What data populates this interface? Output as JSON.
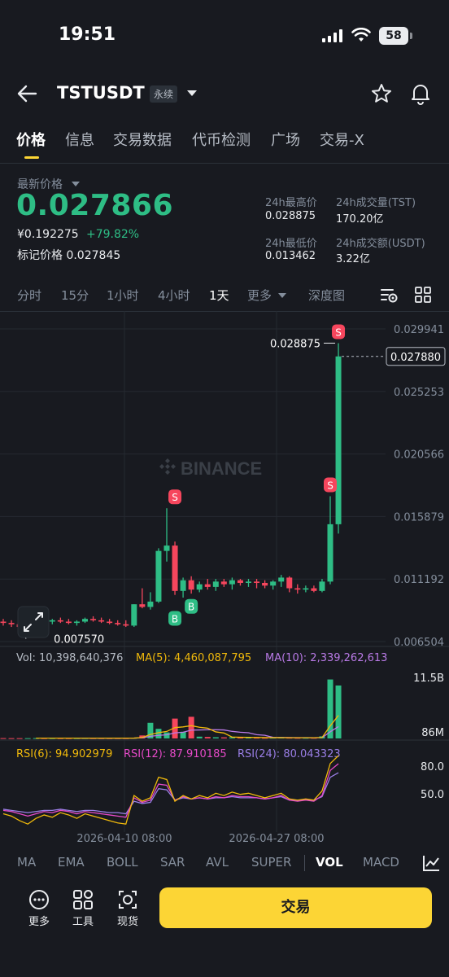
{
  "status_bar": {
    "time": "19:51",
    "battery": "58"
  },
  "header": {
    "symbol": "TSTUSDT",
    "contract_type": "永续"
  },
  "tabs": [
    "价格",
    "信息",
    "交易数据",
    "代币检测",
    "广场",
    "交易-X"
  ],
  "price_block": {
    "latest_label": "最新价格",
    "last_price": "0.027866",
    "cny_price": "¥0.192275",
    "change_pct": "+79.82%",
    "mark_label": "标记价格",
    "mark_price": "0.027845",
    "high_label": "24h最高价",
    "high_value": "0.028875",
    "vol_label": "24h成交量(TST)",
    "vol_value": "170.20亿",
    "low_label": "24h最低价",
    "low_value": "0.013462",
    "turnover_label": "24h成交额(USDT)",
    "turnover_value": "3.22亿"
  },
  "intervals": {
    "items": [
      "分时",
      "15分",
      "1小时",
      "4小时",
      "1天",
      "更多",
      "深度图"
    ],
    "active": "1天"
  },
  "chart_labels": {
    "watermark": "BINANCE",
    "high_marker": "0.028875",
    "low_marker": "0.007570",
    "current_price_tag": "0.027880",
    "vol_line": "Vol: 10,398,640,376",
    "ma5_line": "MA(5): 4,460,087,795",
    "ma10_line": "MA(10): 2,339,262,613",
    "rsi6_line": "RSI(6): 94.902979",
    "rsi12_line": "RSI(12): 87.910185",
    "rsi24_line": "RSI(24): 80.043323",
    "vol_ticks": [
      "11.5B",
      "86M"
    ],
    "rsi_ticks": [
      "80.0",
      "50.0"
    ]
  },
  "chart_data": {
    "type": "candlestick",
    "y_ticks": [
      "0.029941",
      "0.025253",
      "0.020566",
      "0.015879",
      "0.011192",
      "0.006504"
    ],
    "x_ticks": [
      "2026-04-10 08:00",
      "2026-04-27 08:00"
    ],
    "ylim": [
      0.006504,
      0.029941
    ],
    "annotations": {
      "high": "0.028875",
      "low": "0.007570",
      "last": "0.027880"
    },
    "candles": [
      {
        "o": 0.008,
        "h": 0.0082,
        "l": 0.0077,
        "c": 0.0079
      },
      {
        "o": 0.0079,
        "h": 0.0081,
        "l": 0.0076,
        "c": 0.0078
      },
      {
        "o": 0.0078,
        "h": 0.008,
        "l": 0.00757,
        "c": 0.0076
      },
      {
        "o": 0.0076,
        "h": 0.0079,
        "l": 0.0075,
        "c": 0.0078
      },
      {
        "o": 0.0078,
        "h": 0.0082,
        "l": 0.0077,
        "c": 0.0081
      },
      {
        "o": 0.0081,
        "h": 0.0083,
        "l": 0.0079,
        "c": 0.008
      },
      {
        "o": 0.008,
        "h": 0.0082,
        "l": 0.0078,
        "c": 0.0081
      },
      {
        "o": 0.0081,
        "h": 0.0083,
        "l": 0.0079,
        "c": 0.008
      },
      {
        "o": 0.008,
        "h": 0.0082,
        "l": 0.0078,
        "c": 0.0079
      },
      {
        "o": 0.0079,
        "h": 0.0081,
        "l": 0.0077,
        "c": 0.008
      },
      {
        "o": 0.008,
        "h": 0.0083,
        "l": 0.0079,
        "c": 0.0082
      },
      {
        "o": 0.0082,
        "h": 0.0084,
        "l": 0.008,
        "c": 0.0081
      },
      {
        "o": 0.0081,
        "h": 0.0083,
        "l": 0.0079,
        "c": 0.008
      },
      {
        "o": 0.008,
        "h": 0.0082,
        "l": 0.0078,
        "c": 0.0079
      },
      {
        "o": 0.0079,
        "h": 0.0081,
        "l": 0.0077,
        "c": 0.0078
      },
      {
        "o": 0.0078,
        "h": 0.0081,
        "l": 0.0076,
        "c": 0.0077
      },
      {
        "o": 0.0077,
        "h": 0.0093,
        "l": 0.0076,
        "c": 0.0093
      },
      {
        "o": 0.0093,
        "h": 0.0105,
        "l": 0.009,
        "c": 0.0091
      },
      {
        "o": 0.0091,
        "h": 0.0102,
        "l": 0.0089,
        "c": 0.0095
      },
      {
        "o": 0.0095,
        "h": 0.0135,
        "l": 0.0094,
        "c": 0.0133
      },
      {
        "o": 0.0133,
        "h": 0.0165,
        "l": 0.0125,
        "c": 0.0137
      },
      {
        "o": 0.0137,
        "h": 0.014,
        "l": 0.01,
        "c": 0.0103
      },
      {
        "o": 0.0103,
        "h": 0.0113,
        "l": 0.0098,
        "c": 0.0111
      },
      {
        "o": 0.0111,
        "h": 0.0114,
        "l": 0.0101,
        "c": 0.0104
      },
      {
        "o": 0.0104,
        "h": 0.011,
        "l": 0.0102,
        "c": 0.0108
      },
      {
        "o": 0.0108,
        "h": 0.0112,
        "l": 0.0104,
        "c": 0.0106
      },
      {
        "o": 0.0106,
        "h": 0.0112,
        "l": 0.0103,
        "c": 0.011
      },
      {
        "o": 0.011,
        "h": 0.0112,
        "l": 0.0106,
        "c": 0.0108
      },
      {
        "o": 0.0108,
        "h": 0.0113,
        "l": 0.0104,
        "c": 0.0111
      },
      {
        "o": 0.0111,
        "h": 0.0112,
        "l": 0.0107,
        "c": 0.0109
      },
      {
        "o": 0.0109,
        "h": 0.0112,
        "l": 0.0106,
        "c": 0.011
      },
      {
        "o": 0.011,
        "h": 0.0112,
        "l": 0.0105,
        "c": 0.0109
      },
      {
        "o": 0.0109,
        "h": 0.0111,
        "l": 0.0105,
        "c": 0.0107
      },
      {
        "o": 0.0107,
        "h": 0.0111,
        "l": 0.0104,
        "c": 0.011
      },
      {
        "o": 0.011,
        "h": 0.0115,
        "l": 0.0106,
        "c": 0.0113
      },
      {
        "o": 0.0113,
        "h": 0.0114,
        "l": 0.0102,
        "c": 0.0105
      },
      {
        "o": 0.0105,
        "h": 0.0108,
        "l": 0.0101,
        "c": 0.0104
      },
      {
        "o": 0.0104,
        "h": 0.0107,
        "l": 0.0102,
        "c": 0.0105
      },
      {
        "o": 0.0105,
        "h": 0.0107,
        "l": 0.0102,
        "c": 0.0103
      },
      {
        "o": 0.0103,
        "h": 0.0112,
        "l": 0.0102,
        "c": 0.011
      },
      {
        "o": 0.011,
        "h": 0.0174,
        "l": 0.0108,
        "c": 0.0153
      },
      {
        "o": 0.0153,
        "h": 0.028875,
        "l": 0.0146,
        "c": 0.02788
      }
    ],
    "volumes": [
      0.06,
      0.05,
      0.05,
      0.05,
      0.06,
      0.05,
      0.05,
      0.05,
      0.05,
      0.05,
      0.06,
      0.05,
      0.05,
      0.05,
      0.05,
      0.05,
      0.1,
      0.5,
      2.6,
      1.6,
      1.0,
      3.3,
      1.1,
      3.6,
      0.3,
      0.25,
      0.2,
      0.18,
      0.2,
      0.15,
      0.15,
      0.12,
      0.1,
      0.12,
      0.15,
      0.12,
      0.1,
      0.1,
      0.1,
      0.35,
      9.8,
      8.8
    ],
    "vol_ylim": [
      0,
      11.5
    ],
    "vol_unit": "B",
    "series_names": [
      "Vol",
      "MA(5)",
      "MA(10)",
      "RSI(6)",
      "RSI(12)",
      "RSI(24)"
    ],
    "rsi6": [
      44,
      42,
      38,
      35,
      40,
      43,
      41,
      45,
      43,
      40,
      44,
      42,
      40,
      38,
      36,
      35,
      60,
      55,
      58,
      76,
      74,
      55,
      60,
      57,
      60,
      58,
      62,
      60,
      63,
      61,
      62,
      60,
      58,
      60,
      62,
      57,
      56,
      57,
      56,
      64,
      88,
      94.9
    ],
    "rsi12": [
      47,
      46,
      44,
      42,
      44,
      46,
      45,
      47,
      46,
      44,
      46,
      45,
      44,
      43,
      42,
      41,
      58,
      54,
      56,
      70,
      69,
      56,
      59,
      57,
      58,
      57,
      59,
      58,
      60,
      59,
      59,
      58,
      57,
      58,
      60,
      56,
      55,
      56,
      55,
      60,
      82,
      87.9
    ],
    "rsi24": [
      48,
      47,
      46,
      45,
      46,
      47,
      47,
      48,
      47,
      46,
      47,
      47,
      46,
      45,
      45,
      44,
      55,
      53,
      54,
      66,
      65,
      56,
      58,
      57,
      58,
      57,
      58,
      58,
      59,
      58,
      58,
      58,
      57,
      58,
      59,
      56,
      56,
      56,
      56,
      59,
      76,
      80.0
    ],
    "rsi_ylim": [
      28,
      95
    ]
  },
  "chart_colors": {
    "up": "#2ebd85",
    "down": "#f6465d",
    "ma5": "#f0b90b",
    "ma10": "#b97ae6",
    "rsi6": "#f0b90b",
    "rsi12": "#e64ac8",
    "rsi24": "#9a7ee6"
  },
  "indicators": {
    "items": [
      "MA",
      "EMA",
      "BOLL",
      "SAR",
      "AVL",
      "SUPER",
      "VOL",
      "MACD"
    ],
    "active": "VOL"
  },
  "bottom_bar": {
    "more": "更多",
    "tools": "工具",
    "spot": "现货",
    "trade": "交易"
  }
}
